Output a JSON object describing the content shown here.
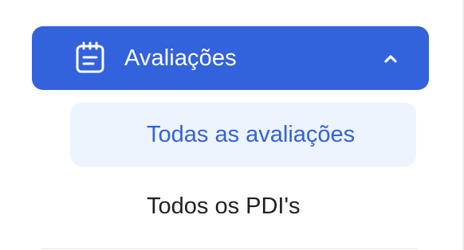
{
  "menu": {
    "label": "Avaliações",
    "icon": "notepad-icon",
    "expand_icon": "chevron-up-icon",
    "accent_color": "#3262dc",
    "items": [
      {
        "label": "Todas as avaliações",
        "active": true
      },
      {
        "label": "Todos os PDI's",
        "active": false
      }
    ]
  }
}
